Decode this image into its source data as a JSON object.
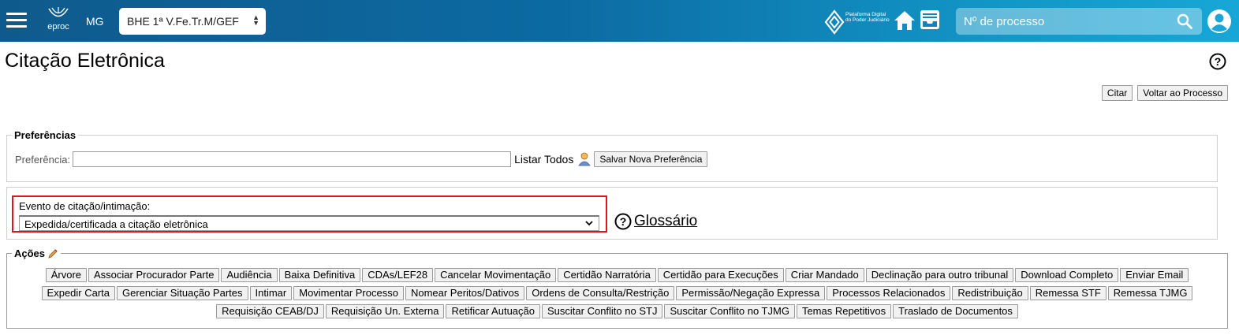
{
  "topbar": {
    "logo_text": "eproc",
    "state": "MG",
    "unit_select": "BHE 1ª V.Fe.Tr.M/GEF",
    "pdpj_text": "Plataforma Digital do Poder Judiciário",
    "search_placeholder": "Nº de processo"
  },
  "page": {
    "title": "Citação Eletrônica",
    "citar_label": "Citar",
    "voltar_label": "Voltar ao Processo"
  },
  "preferencias": {
    "legend": "Preferências",
    "label": "Preferência:",
    "value": "",
    "listar_todos": "Listar Todos",
    "salvar_label": "Salvar Nova Preferência"
  },
  "evento": {
    "label": "Evento de citação/intimação:",
    "selected": "Expedida/certificada a citação eletrônica",
    "glossario": "Glossário"
  },
  "acoes": {
    "legend": "Ações",
    "rows": [
      [
        "Árvore",
        "Associar Procurador Parte",
        "Audiência",
        "Baixa Definitiva",
        "CDAs/LEF28",
        "Cancelar Movimentação",
        "Certidão Narratória",
        "Certidão para Execuções",
        "Criar Mandado",
        "Declinação para outro tribunal",
        "Download Completo",
        "Enviar Email"
      ],
      [
        "Expedir Carta",
        "Gerenciar Situação Partes",
        "Intimar",
        "Movimentar Processo",
        "Nomear Peritos/Dativos",
        "Ordens de Consulta/Restrição",
        "Permissão/Negação Expressa",
        "Processos Relacionados",
        "Redistribuição",
        "Remessa STF",
        "Remessa TJMG"
      ],
      [
        "Requisição CEAB/DJ",
        "Requisição Un. Externa",
        "Retificar Autuação",
        "Suscitar Conflito no STJ",
        "Suscitar Conflito no TJMG",
        "Temas Repetitivos",
        "Traslado de Documentos"
      ]
    ]
  },
  "colors": {
    "topbar_start": "#0f5a8c",
    "topbar_end": "#17a7d6",
    "highlight_border": "#e0141e"
  },
  "icons": [
    "hamburger-icon",
    "eproc-logo-icon",
    "pdpj-logo-icon",
    "home-icon",
    "inbox-icon",
    "search-icon",
    "user-icon",
    "help-icon",
    "person-icon",
    "edit-icon",
    "chevron-down-icon"
  ]
}
